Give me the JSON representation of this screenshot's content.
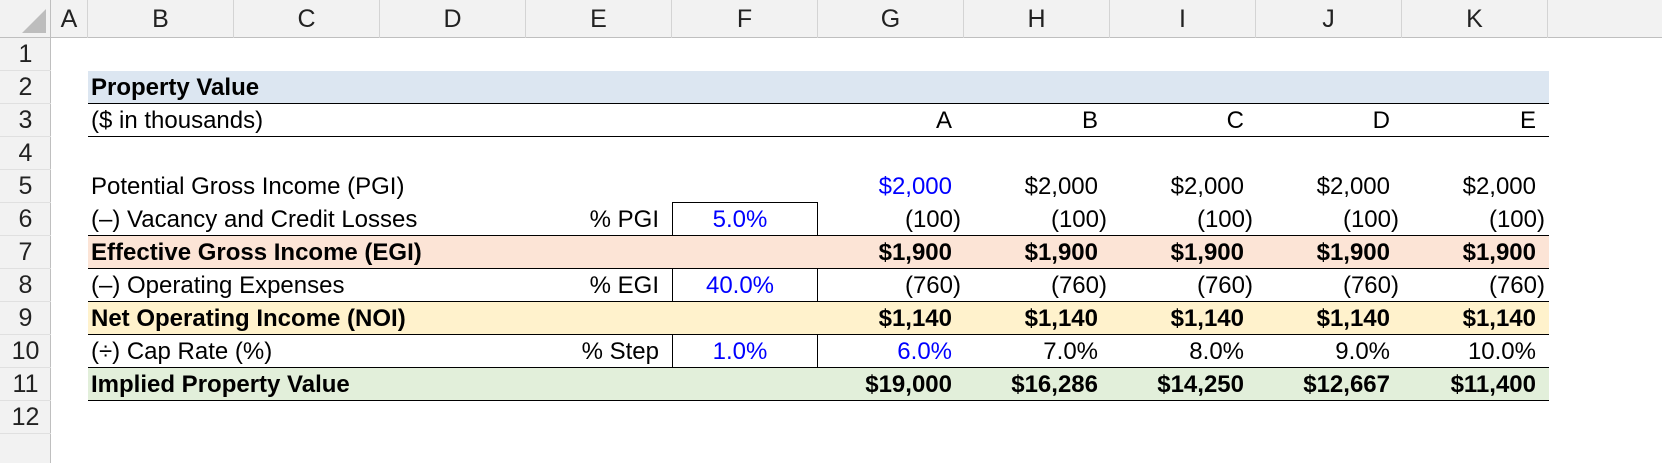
{
  "spreadsheet": {
    "corner": "",
    "columns": [
      "A",
      "B",
      "C",
      "D",
      "E",
      "F",
      "G",
      "H",
      "I",
      "J",
      "K"
    ],
    "rows": [
      "1",
      "2",
      "3",
      "4",
      "5",
      "6",
      "7",
      "8",
      "9",
      "10",
      "11",
      "12"
    ],
    "title": "Property Value",
    "subtitle": "($ in thousands)",
    "scenarios": [
      "A",
      "B",
      "C",
      "D",
      "E"
    ],
    "lines": {
      "pgi": {
        "label": "Potential Gross Income (PGI)",
        "values": [
          "$2,000",
          "$2,000",
          "$2,000",
          "$2,000",
          "$2,000"
        ]
      },
      "vacancy": {
        "label": "(–) Vacancy and Credit Losses",
        "unit": "% PGI",
        "input": "5.0%",
        "values": [
          "(100)",
          "(100)",
          "(100)",
          "(100)",
          "(100)"
        ]
      },
      "egi": {
        "label": "Effective Gross Income (EGI)",
        "values": [
          "$1,900",
          "$1,900",
          "$1,900",
          "$1,900",
          "$1,900"
        ]
      },
      "opex": {
        "label": "(–) Operating Expenses",
        "unit": "% EGI",
        "input": "40.0%",
        "values": [
          "(760)",
          "(760)",
          "(760)",
          "(760)",
          "(760)"
        ]
      },
      "noi": {
        "label": "Net Operating Income (NOI)",
        "values": [
          "$1,140",
          "$1,140",
          "$1,140",
          "$1,140",
          "$1,140"
        ]
      },
      "cap": {
        "label": "(÷) Cap Rate (%)",
        "unit": "% Step",
        "input": "1.0%",
        "values": [
          "6.0%",
          "7.0%",
          "8.0%",
          "9.0%",
          "10.0%"
        ]
      },
      "value": {
        "label": "Implied Property Value",
        "values": [
          "$19,000",
          "$16,286",
          "$14,250",
          "$12,667",
          "$11,400"
        ]
      }
    },
    "colors": {
      "title_band": "#dce6f1",
      "egi_band": "#fce4d6",
      "noi_band": "#fff2cc",
      "value_band": "#e2efda",
      "input_font": "#0000ff"
    }
  }
}
